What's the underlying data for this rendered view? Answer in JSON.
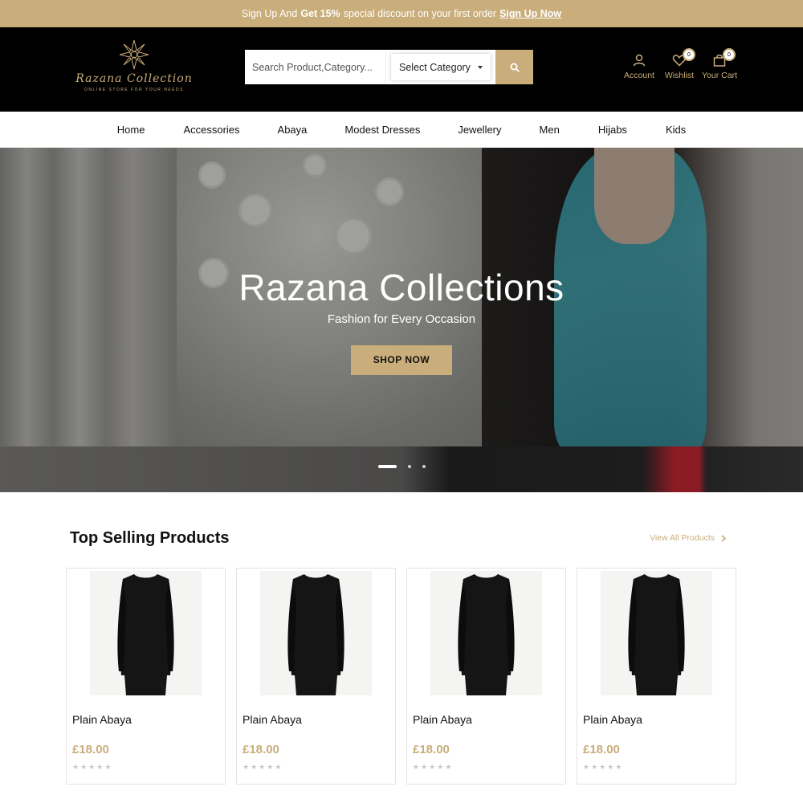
{
  "promo": {
    "text_prefix": "Sign Up And",
    "text_bold": "Get 15%",
    "text_suffix": "special discount on your first order",
    "link": "Sign Up Now"
  },
  "header": {
    "logo_name": "Razana Collection",
    "logo_tagline": "ONLINE STORE FOR YOUR NEEDS",
    "search_placeholder": "Search Product,Category...",
    "category_select": "Select Category",
    "icons": [
      {
        "label": "Account",
        "icon": "user-icon"
      },
      {
        "label": "Wishlist",
        "icon": "heart-icon",
        "badge": "0"
      },
      {
        "label": "Your Cart",
        "icon": "bag-icon",
        "badge": "0"
      }
    ]
  },
  "nav": {
    "items": [
      "Home",
      "Accessories",
      "Abaya",
      "Modest Dresses",
      "Jewellery",
      "Men",
      "Hijabs",
      "Kids"
    ]
  },
  "hero": {
    "title": "Razana Collections",
    "subtitle": "Fashion for Every Occasion",
    "button": "SHOP NOW",
    "slides": 3,
    "active_slide": 1
  },
  "products": {
    "title": "Top Selling Products",
    "view_all": "View All Products",
    "items": [
      {
        "name": "Plain Abaya",
        "price": "£18.00",
        "rating": 0
      },
      {
        "name": "Plain Abaya",
        "price": "£18.00",
        "rating": 0
      },
      {
        "name": "Plain Abaya",
        "price": "£18.00",
        "rating": 0
      },
      {
        "name": "Plain Abaya",
        "price": "£18.00",
        "rating": 0
      }
    ]
  },
  "colors": {
    "accent": "#c9ad7a",
    "header_bg": "#000000"
  }
}
